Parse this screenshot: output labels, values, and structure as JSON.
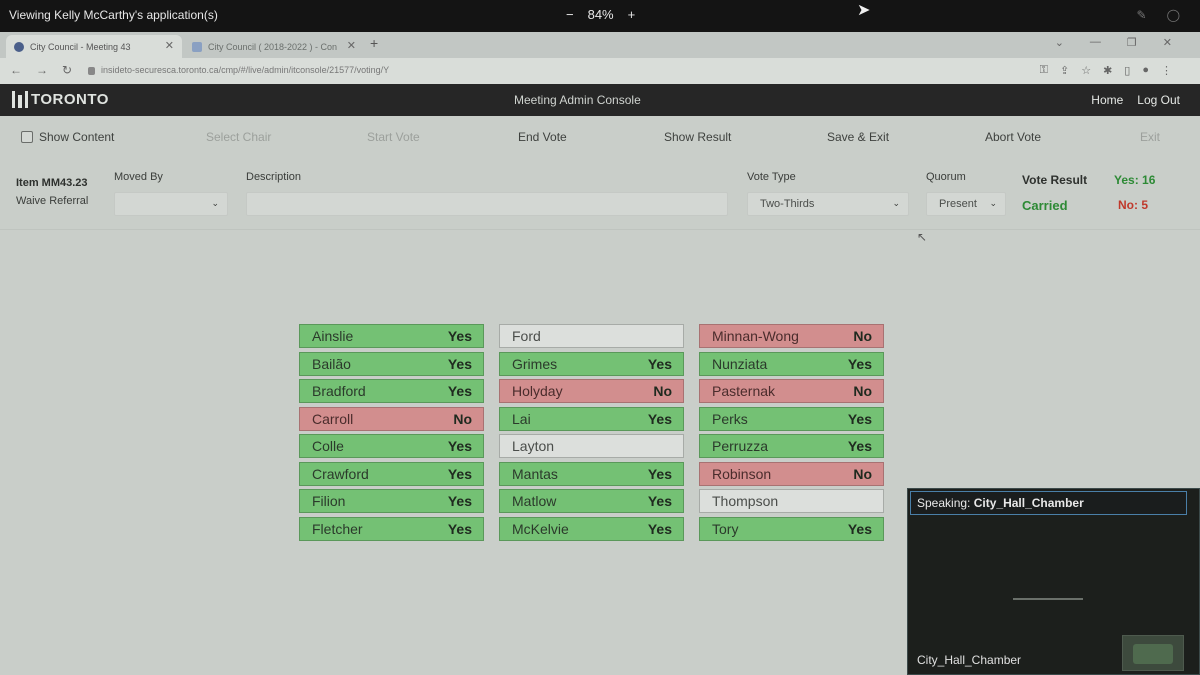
{
  "sharebar": {
    "viewing": "Viewing Kelly McCarthy's application(s)",
    "zoom_minus": "−",
    "zoom_level": "84%",
    "zoom_plus": "+"
  },
  "browser": {
    "tabs": [
      {
        "label": "City Council - Meeting 43"
      },
      {
        "label": "City Council ( 2018-2022 ) - Con"
      }
    ],
    "new_tab": "+",
    "url": "insideto-securesca.toronto.ca/cmp/#/live/admin/itconsole/21577/voting/Y"
  },
  "app": {
    "logo": "TORONTO",
    "title": "Meeting Admin Console",
    "home": "Home",
    "logout": "Log Out"
  },
  "toolbar": {
    "show_content": "Show Content",
    "select_chair": "Select Chair",
    "start_vote": "Start Vote",
    "end_vote": "End Vote",
    "show_result": "Show Result",
    "save_exit": "Save & Exit",
    "abort_vote": "Abort Vote",
    "exit": "Exit"
  },
  "form": {
    "item_number": "Item MM43.23",
    "item_desc": "Waive Referral",
    "moved_by_label": "Moved By",
    "moved_by_value": "",
    "description_label": "Description",
    "vote_type_label": "Vote Type",
    "vote_type_value": "Two-Thirds",
    "quorum_label": "Quorum",
    "quorum_value": "Present",
    "vote_result_label": "Vote Result",
    "vote_status": "Carried",
    "yes_count": "Yes: 16",
    "no_count": "No: 5"
  },
  "colors": {
    "yes": "#74c174",
    "no": "#d28e8e",
    "none": "#dcdfdc",
    "carried": "#2d8a35",
    "no_text": "#c0392b"
  },
  "votes": [
    [
      {
        "name": "Ainslie",
        "vote": "Yes"
      },
      {
        "name": "Bailão",
        "vote": "Yes"
      },
      {
        "name": "Bradford",
        "vote": "Yes"
      },
      {
        "name": "Carroll",
        "vote": "No"
      },
      {
        "name": "Colle",
        "vote": "Yes"
      },
      {
        "name": "Crawford",
        "vote": "Yes"
      },
      {
        "name": "Filion",
        "vote": "Yes"
      },
      {
        "name": "Fletcher",
        "vote": "Yes"
      }
    ],
    [
      {
        "name": "Ford",
        "vote": ""
      },
      {
        "name": "Grimes",
        "vote": "Yes"
      },
      {
        "name": "Holyday",
        "vote": "No"
      },
      {
        "name": "Lai",
        "vote": "Yes"
      },
      {
        "name": "Layton",
        "vote": ""
      },
      {
        "name": "Mantas",
        "vote": "Yes"
      },
      {
        "name": "Matlow",
        "vote": "Yes"
      },
      {
        "name": "McKelvie",
        "vote": "Yes"
      }
    ],
    [
      {
        "name": "Minnan-Wong",
        "vote": "No"
      },
      {
        "name": "Nunziata",
        "vote": "Yes"
      },
      {
        "name": "Pasternak",
        "vote": "No"
      },
      {
        "name": "Perks",
        "vote": "Yes"
      },
      {
        "name": "Perruzza",
        "vote": "Yes"
      },
      {
        "name": "Robinson",
        "vote": "No"
      },
      {
        "name": "Thompson",
        "vote": ""
      },
      {
        "name": "Tory",
        "vote": "Yes"
      }
    ]
  ],
  "video": {
    "speaking_label": "Speaking:",
    "speaking_name": "City_Hall_Chamber",
    "room_name": "City_Hall_Chamber"
  }
}
